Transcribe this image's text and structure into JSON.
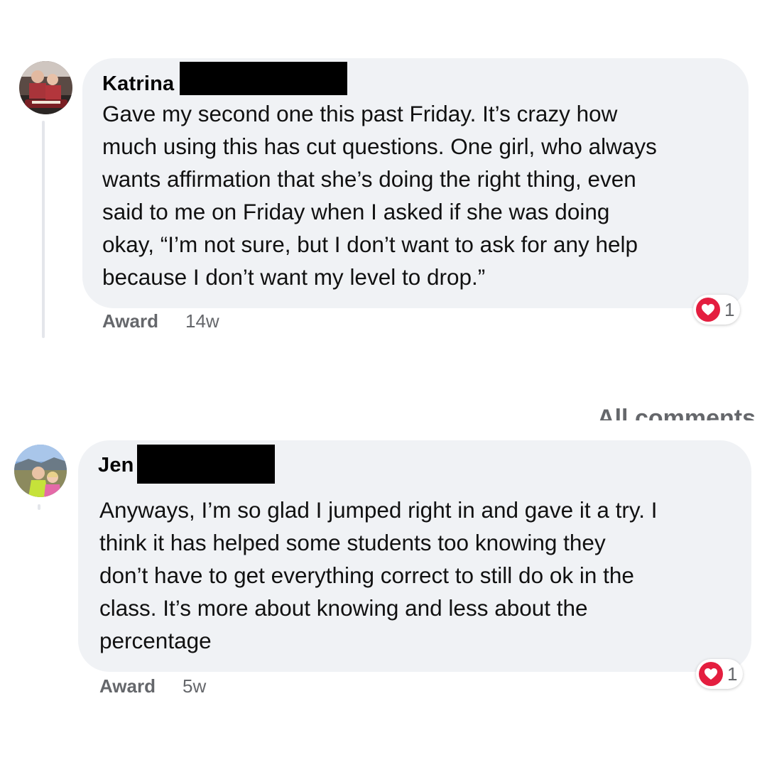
{
  "comments": [
    {
      "author_first": "Katrina",
      "lines": [
        "Gave my second one this past Friday. It’s crazy how",
        "much using this has cut questions. One girl, who always",
        "wants affirmation that she’s doing the right thing, even",
        "said to me on Friday when I asked if she was doing",
        "okay, “I’m not sure, but I don’t want to ask for any help",
        "because I don’t want my level to drop.”"
      ],
      "award_label": "Award",
      "time": "14w",
      "reaction_count": "1"
    },
    {
      "author_first": "Jen",
      "lines": [
        "Anyways, I’m so glad I jumped right in and gave it a try. I",
        "think it has helped some students too knowing they",
        "don’t have to get everything correct to still do ok in the",
        "class. It’s more about knowing and less about the",
        "percentage"
      ],
      "award_label": "Award",
      "time": "5w",
      "reaction_count": "1"
    }
  ],
  "all_comments_label": "All comments",
  "colors": {
    "bubble": "#f0f2f5",
    "reaction_heart": "#e41e3f",
    "secondary_text": "#65676b",
    "redaction": "#000000"
  },
  "icons": {
    "reaction": "heart-icon"
  }
}
